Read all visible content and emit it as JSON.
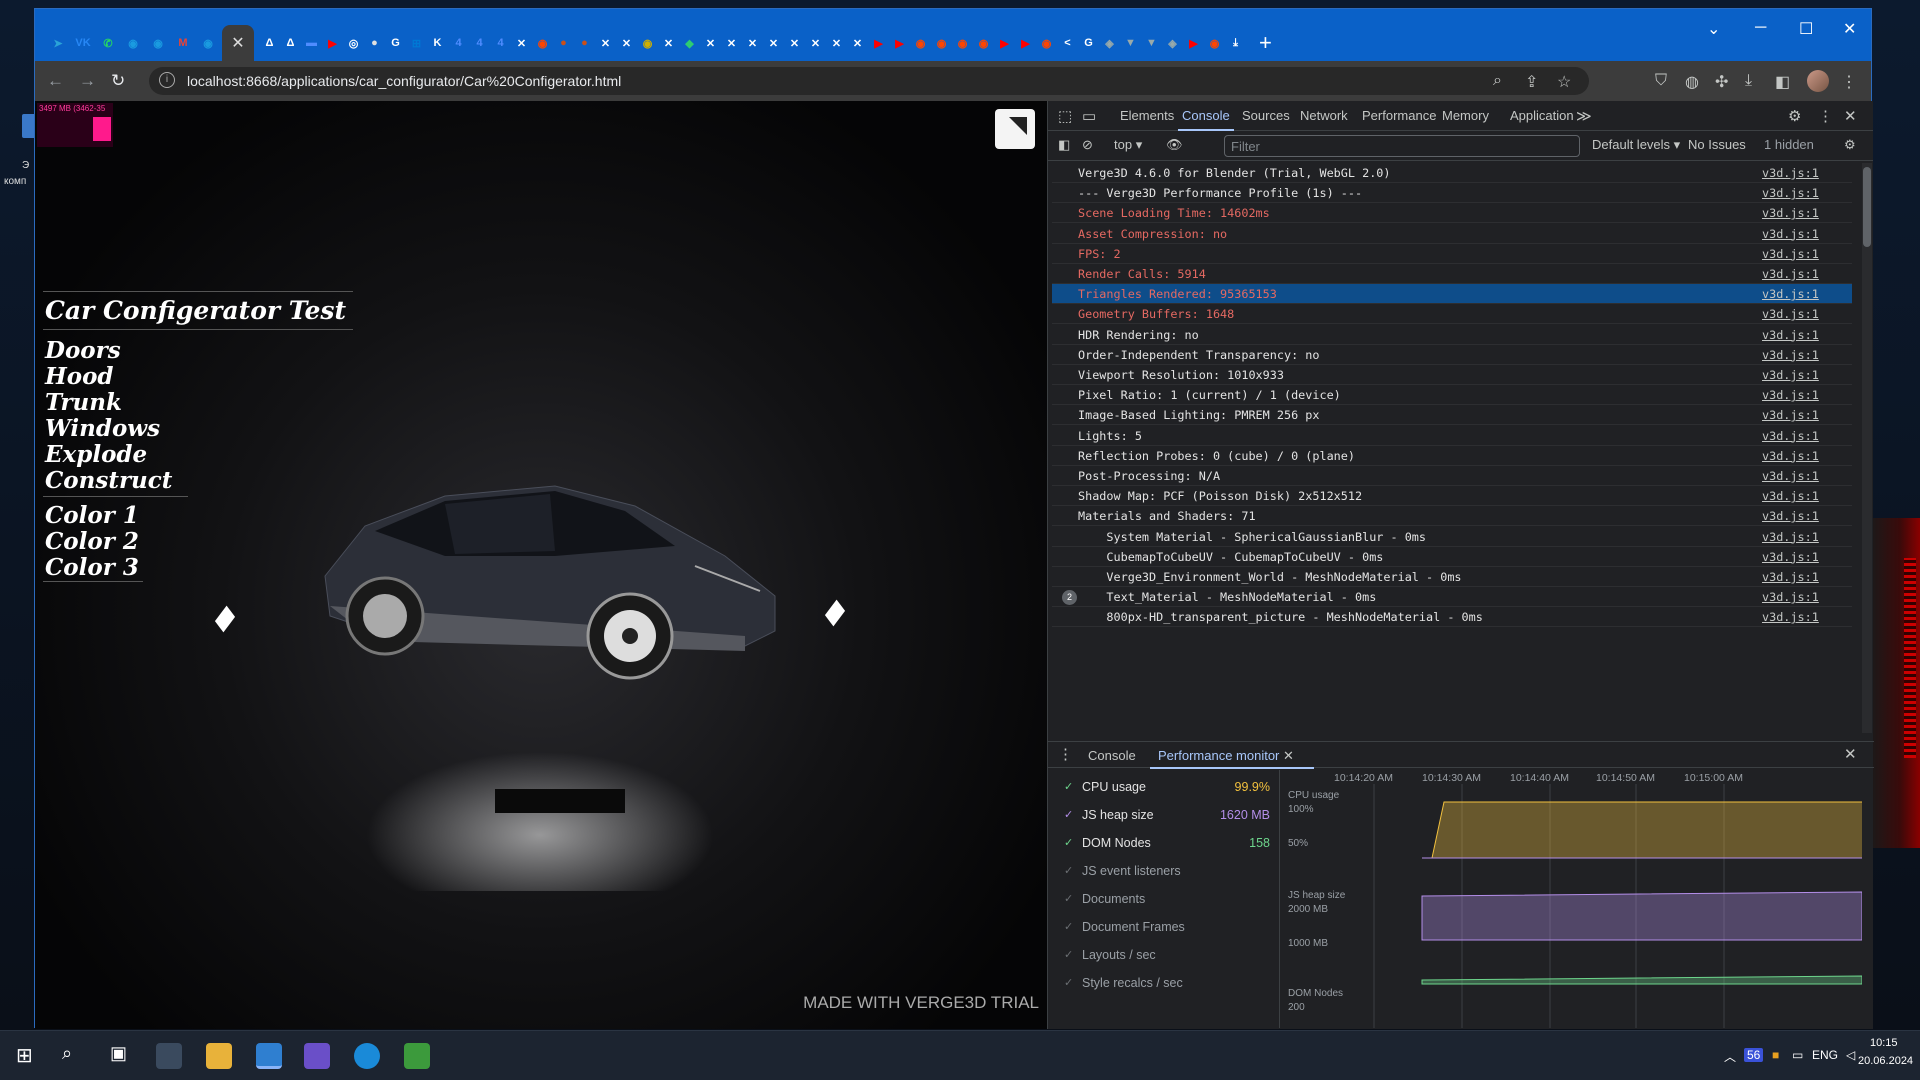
{
  "desktop": {
    "icon_label_1": "Э",
    "icon_label_2": "комп"
  },
  "browser": {
    "tabs": [
      {
        "icon": "telegram-icon",
        "color": "#2aa3d8",
        "glyph": "➤"
      },
      {
        "icon": "vk-icon",
        "color": "#2787f5",
        "glyph": "VK"
      },
      {
        "icon": "whatsapp-icon",
        "color": "#25d366",
        "glyph": "✆"
      },
      {
        "icon": "app-icon",
        "color": "#1a9be0",
        "glyph": "◉"
      },
      {
        "icon": "app-icon",
        "color": "#1a9be0",
        "glyph": "◉"
      },
      {
        "icon": "gmail-icon",
        "color": "#ea4335",
        "glyph": "M"
      },
      {
        "icon": "app-icon",
        "color": "#1a9be0",
        "glyph": "◉"
      }
    ],
    "active_tab_close": "✕",
    "more_tabs": [
      {
        "color": "#ffffff",
        "glyph": "Δ"
      },
      {
        "color": "#ffffff",
        "glyph": "Δ"
      },
      {
        "color": "#4f8cff",
        "glyph": "▬"
      },
      {
        "color": "#ff0000",
        "glyph": "▶"
      },
      {
        "color": "#ffffff",
        "glyph": "◎"
      },
      {
        "color": "#e0e0e0",
        "glyph": "●"
      },
      {
        "color": "#ffffff",
        "glyph": "G"
      },
      {
        "color": "#0078d4",
        "glyph": "⊞"
      },
      {
        "color": "#ffffff",
        "glyph": "K"
      },
      {
        "color": "#4f8cff",
        "glyph": "4"
      },
      {
        "color": "#4f8cff",
        "glyph": "4"
      },
      {
        "color": "#4f8cff",
        "glyph": "4"
      },
      {
        "color": "#ffffff",
        "glyph": "✕"
      },
      {
        "color": "#ff4500",
        "glyph": "◉"
      },
      {
        "color": "#c8501a",
        "glyph": "●"
      },
      {
        "color": "#c8501a",
        "glyph": "●"
      },
      {
        "color": "#ffffff",
        "glyph": "✕"
      },
      {
        "color": "#ffffff",
        "glyph": "✕"
      },
      {
        "color": "#d0b000",
        "glyph": "◉"
      },
      {
        "color": "#ffffff",
        "glyph": "✕"
      },
      {
        "color": "#2ecc71",
        "glyph": "◆"
      },
      {
        "color": "#ffffff",
        "glyph": "✕"
      },
      {
        "color": "#ffffff",
        "glyph": "✕"
      },
      {
        "color": "#ffffff",
        "glyph": "✕"
      },
      {
        "color": "#ffffff",
        "glyph": "✕"
      },
      {
        "color": "#ffffff",
        "glyph": "✕"
      },
      {
        "color": "#ffffff",
        "glyph": "✕"
      },
      {
        "color": "#ffffff",
        "glyph": "✕"
      },
      {
        "color": "#ffffff",
        "glyph": "✕"
      },
      {
        "color": "#ff0000",
        "glyph": "▶"
      },
      {
        "color": "#ff0000",
        "glyph": "▶"
      },
      {
        "color": "#ff4500",
        "glyph": "◉"
      },
      {
        "color": "#ff4500",
        "glyph": "◉"
      },
      {
        "color": "#ff4500",
        "glyph": "◉"
      },
      {
        "color": "#ff4500",
        "glyph": "◉"
      },
      {
        "color": "#ff0000",
        "glyph": "▶"
      },
      {
        "color": "#ff0000",
        "glyph": "▶"
      },
      {
        "color": "#ff4500",
        "glyph": "◉"
      },
      {
        "color": "#ffffff",
        "glyph": "<"
      },
      {
        "color": "#ffffff",
        "glyph": "G"
      },
      {
        "color": "#9aa",
        "glyph": "◈"
      },
      {
        "color": "#9aa",
        "glyph": "▼"
      },
      {
        "color": "#9aa",
        "glyph": "▼"
      },
      {
        "color": "#9aa",
        "glyph": "◈"
      },
      {
        "color": "#ff0000",
        "glyph": "▶"
      },
      {
        "color": "#ff4500",
        "glyph": "◉"
      },
      {
        "color": "#ffffff",
        "glyph": "⤓"
      }
    ],
    "new_tab": "+",
    "window_controls": {
      "dropdown": "⌄",
      "minimize": "─",
      "maximize": "☐",
      "close": "✕"
    },
    "url": "localhost:8668/applications/car_configurator/Car%20Configerator.html",
    "url_info_icon": "i"
  },
  "viewport": {
    "stats_text": "3497 MB (3462-35",
    "menu_title": "Car Configerator Test",
    "menu_items": [
      "Doors",
      "Hood",
      "Trunk",
      "Windows",
      "Explode",
      "Construct"
    ],
    "color_items": [
      "Color 1",
      "Color 2",
      "Color 3"
    ],
    "watermark": "MADE WITH VERGE3D TRIAL"
  },
  "devtools": {
    "tabs": [
      "Elements",
      "Console",
      "Sources",
      "Network",
      "Performance",
      "Memory",
      "Application"
    ],
    "active_tab": "Console",
    "more_tabs": "≫",
    "context": "top",
    "filter_placeholder": "Filter",
    "levels": "Default levels",
    "issues": "No Issues",
    "hidden": "1 hidden",
    "logs": [
      {
        "msg": "Verge3D 4.6.0 for Blender (Trial, WebGL 2.0)",
        "src": "v3d.js:1",
        "style": "normal"
      },
      {
        "msg": "--- Verge3D Performance Profile (1s) ---",
        "src": "v3d.js:1",
        "style": "normal"
      },
      {
        "msg": "Scene Loading Time: 14602ms",
        "src": "v3d.js:1",
        "style": "red"
      },
      {
        "msg": "Asset Compression: no",
        "src": "v3d.js:1",
        "style": "red"
      },
      {
        "msg": "FPS: 2",
        "src": "v3d.js:1",
        "style": "red"
      },
      {
        "msg": "Render Calls: 5914",
        "src": "v3d.js:1",
        "style": "red"
      },
      {
        "msg": "Triangles Rendered: 95365153",
        "src": "v3d.js:1",
        "style": "sel"
      },
      {
        "msg": "Geometry Buffers: 1648",
        "src": "v3d.js:1",
        "style": "red"
      },
      {
        "msg": "HDR Rendering: no",
        "src": "v3d.js:1",
        "style": "normal"
      },
      {
        "msg": "Order-Independent Transparency: no",
        "src": "v3d.js:1",
        "style": "normal"
      },
      {
        "msg": "Viewport Resolution: 1010x933",
        "src": "v3d.js:1",
        "style": "normal"
      },
      {
        "msg": "Pixel Ratio: 1 (current) / 1 (device)",
        "src": "v3d.js:1",
        "style": "normal"
      },
      {
        "msg": "Image-Based Lighting: PMREM 256 px",
        "src": "v3d.js:1",
        "style": "normal"
      },
      {
        "msg": "Lights: 5",
        "src": "v3d.js:1",
        "style": "normal"
      },
      {
        "msg": "Reflection Probes: 0 (cube) / 0 (plane)",
        "src": "v3d.js:1",
        "style": "normal"
      },
      {
        "msg": "Post-Processing: N/A",
        "src": "v3d.js:1",
        "style": "normal"
      },
      {
        "msg": "Shadow Map: PCF (Poisson Disk) 2x512x512",
        "src": "v3d.js:1",
        "style": "normal"
      },
      {
        "msg": "Materials and Shaders: 71",
        "src": "v3d.js:1",
        "style": "normal"
      },
      {
        "msg": "    System Material - SphericalGaussianBlur - 0ms",
        "src": "v3d.js:1",
        "style": "normal"
      },
      {
        "msg": "    CubemapToCubeUV - CubemapToCubeUV - 0ms",
        "src": "v3d.js:1",
        "style": "normal"
      },
      {
        "msg": "    Verge3D_Environment_World - MeshNodeMaterial - 0ms",
        "src": "v3d.js:1",
        "style": "normal"
      },
      {
        "msg": "    Text_Material - MeshNodeMaterial - 0ms",
        "src": "v3d.js:1",
        "style": "normal",
        "count": "2"
      },
      {
        "msg": "    800px-HD_transparent_picture - MeshNodeMaterial - 0ms",
        "src": "v3d.js:1",
        "style": "normal"
      }
    ],
    "drawer": {
      "tabs": [
        "Console",
        "Performance monitor"
      ],
      "active": "Performance monitor",
      "metrics": [
        {
          "name": "CPU usage",
          "value": "99.9%",
          "color": "#f2c13e",
          "on": true
        },
        {
          "name": "JS heap size",
          "value": "1620 MB",
          "color": "#b38ee8",
          "on": true
        },
        {
          "name": "DOM Nodes",
          "value": "158",
          "color": "#6dd58c",
          "on": true
        },
        {
          "name": "JS event listeners",
          "value": "",
          "color": "",
          "on": false
        },
        {
          "name": "Documents",
          "value": "",
          "color": "",
          "on": false
        },
        {
          "name": "Document Frames",
          "value": "",
          "color": "",
          "on": false
        },
        {
          "name": "Layouts / sec",
          "value": "",
          "color": "",
          "on": false
        },
        {
          "name": "Style recalcs / sec",
          "value": "",
          "color": "",
          "on": false
        }
      ],
      "times": [
        "10:14:20 AM",
        "10:14:30 AM",
        "10:14:40 AM",
        "10:14:50 AM",
        "10:15:00 AM"
      ],
      "graph_labels": {
        "cpu": "CPU usage",
        "cpu_100": "100%",
        "cpu_50": "50%",
        "heap": "JS heap size",
        "heap_2000": "2000 MB",
        "heap_1000": "1000 MB",
        "dom": "DOM Nodes",
        "dom_200": "200"
      }
    }
  },
  "taskbar": {
    "lang": "ENG",
    "time": "10:15",
    "date": "20.06.2024",
    "badge": "56"
  }
}
